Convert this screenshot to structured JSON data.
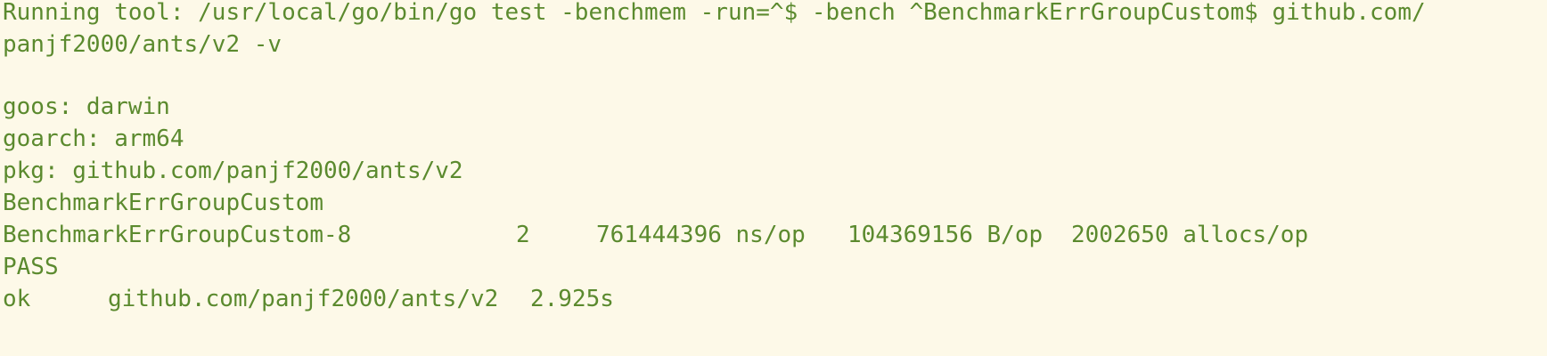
{
  "output": {
    "command_line_1": "Running tool: /usr/local/go/bin/go test -benchmem -run=^$ -bench ^BenchmarkErrGroupCustom$ github.com/",
    "command_line_2": "panjf2000/ants/v2 -v",
    "goos": "goos: darwin",
    "goarch": "goarch: arm64",
    "pkg": "pkg: github.com/panjf2000/ants/v2",
    "benchmark_name": "BenchmarkErrGroupCustom",
    "result": {
      "name": "BenchmarkErrGroupCustom-8",
      "iterations": "2",
      "ns_per_op": "761444396 ns/op",
      "bytes_per_op": "104369156 B/op",
      "allocs_per_op": "2002650 allocs/op"
    },
    "status": "PASS",
    "summary": {
      "result": "ok",
      "package": "github.com/panjf2000/ants/v2",
      "duration": "2.925s"
    }
  }
}
